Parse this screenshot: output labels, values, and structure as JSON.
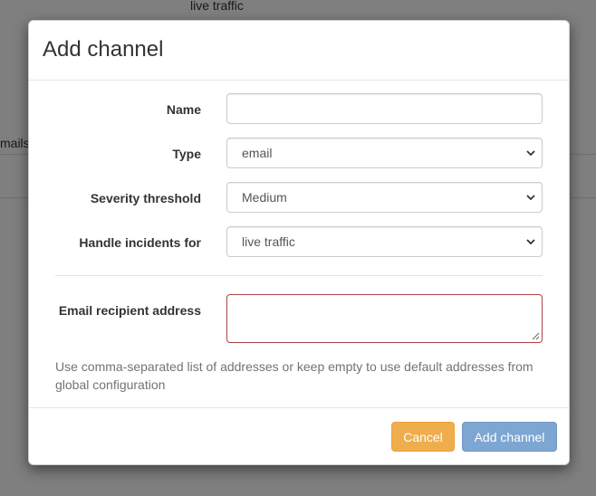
{
  "background": {
    "top_text": "live traffic",
    "left_text": "mails"
  },
  "modal": {
    "title": "Add channel",
    "fields": {
      "name": {
        "label": "Name",
        "value": ""
      },
      "type": {
        "label": "Type",
        "value": "email"
      },
      "severity": {
        "label": "Severity threshold",
        "value": "Medium"
      },
      "handle": {
        "label": "Handle incidents for",
        "value": "live traffic"
      },
      "email": {
        "label": "Email recipient address",
        "value": ""
      }
    },
    "help_text": "Use comma-separated list of addresses or keep empty to use default addresses from global configuration",
    "buttons": {
      "cancel": "Cancel",
      "add": "Add channel"
    }
  },
  "colors": {
    "cancel_button": "#f0ad4e",
    "add_button": "#7ea6d2",
    "textarea_error_border": "#a94442"
  },
  "icons": {
    "select_arrow": "chevron-down-icon",
    "textarea_grip": "resize-grip-icon"
  }
}
